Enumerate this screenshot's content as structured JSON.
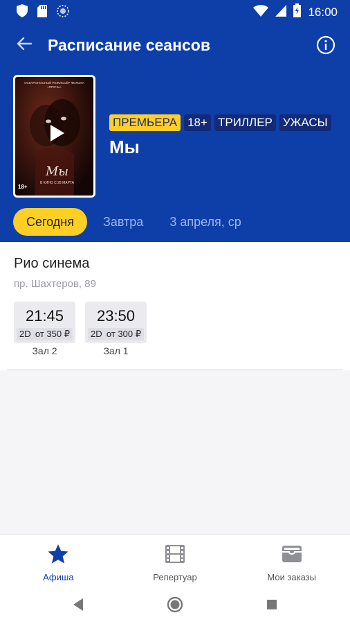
{
  "status_bar": {
    "time": "16:00"
  },
  "toolbar": {
    "title": "Расписание сеансов"
  },
  "poster": {
    "credits": [
      "ОСКАРОНОСНЫЙ РЕЖИССЁР ФИЛЬМА",
      "«ПРОЧЬ»"
    ],
    "title": "Мы",
    "date": "В КИНО С 28 МАРТА",
    "age": "18+"
  },
  "movie": {
    "tags": [
      "ПРЕМЬЕРА",
      "18+",
      "ТРИЛЛЕР",
      "УЖАСЫ"
    ],
    "title": "Мы"
  },
  "dates": {
    "items": [
      "Сегодня",
      "Завтра",
      "3 апреля, ср"
    ],
    "selected": 0
  },
  "cinema": {
    "name": "Рио синема",
    "address": "пр. Шахтеров, 89",
    "sessions": [
      {
        "time": "21:45",
        "format": "2D",
        "price": "от 350 ₽",
        "hall": "Зал 2"
      },
      {
        "time": "23:50",
        "format": "2D",
        "price": "от 300 ₽",
        "hall": "Зал 1"
      }
    ]
  },
  "bottom_nav": {
    "items": [
      {
        "label": "Афиша",
        "icon": "star-icon",
        "active": true
      },
      {
        "label": "Репертуар",
        "icon": "film-icon",
        "active": false
      },
      {
        "label": "Мои заказы",
        "icon": "wallet-icon",
        "active": false
      }
    ]
  },
  "colors": {
    "primary": "#0e3fa8",
    "accent": "#ffcf26",
    "tag": "#132a78"
  }
}
